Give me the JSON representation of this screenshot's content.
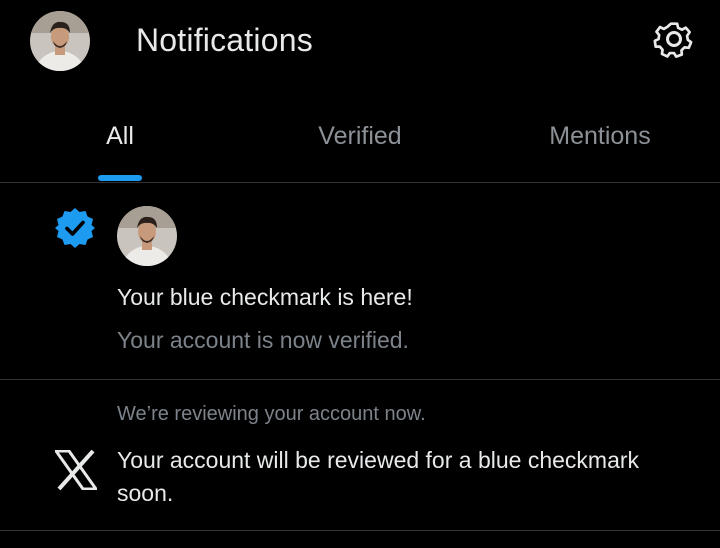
{
  "header": {
    "title": "Notifications",
    "avatar_icon": "profile-avatar",
    "settings_icon": "gear-icon"
  },
  "tabs": [
    {
      "label": "All",
      "active": true
    },
    {
      "label": "Verified",
      "active": false
    },
    {
      "label": "Mentions",
      "active": false
    }
  ],
  "notifications": [
    {
      "icon": "verified-badge-icon",
      "title": "Your blue checkmark is here!",
      "subtitle": "Your account is now verified."
    },
    {
      "icon": "x-logo-icon",
      "subtitle": "We’re reviewing your account now.",
      "body": "Your account will be reviewed for a blue checkmark soon."
    }
  ],
  "colors": {
    "background": "#000000",
    "text_primary": "#e7e9ea",
    "text_secondary": "#7c838a",
    "accent": "#1d9bf0",
    "divider": "#2f3336"
  }
}
